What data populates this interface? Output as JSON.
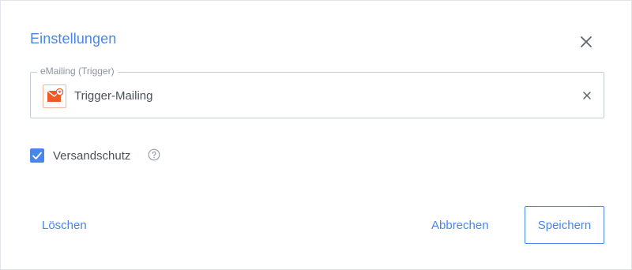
{
  "dialog": {
    "title": "Einstellungen",
    "close_icon": "close-icon"
  },
  "mailing_field": {
    "legend": "eMailing (Trigger)",
    "value": "Trigger-Mailing",
    "icon": "trigger-mailing-icon",
    "clear_icon": "clear-icon",
    "icon_color": "#f05a22"
  },
  "options": {
    "versandschutz_label": "Versandschutz",
    "versandschutz_checked": true,
    "help_icon": "help-circle-icon"
  },
  "actions": {
    "delete_label": "Löschen",
    "cancel_label": "Abbrechen",
    "save_label": "Speichern"
  },
  "colors": {
    "accent": "#4a86e8",
    "text": "#4b5058",
    "border": "#c6cbd3"
  }
}
